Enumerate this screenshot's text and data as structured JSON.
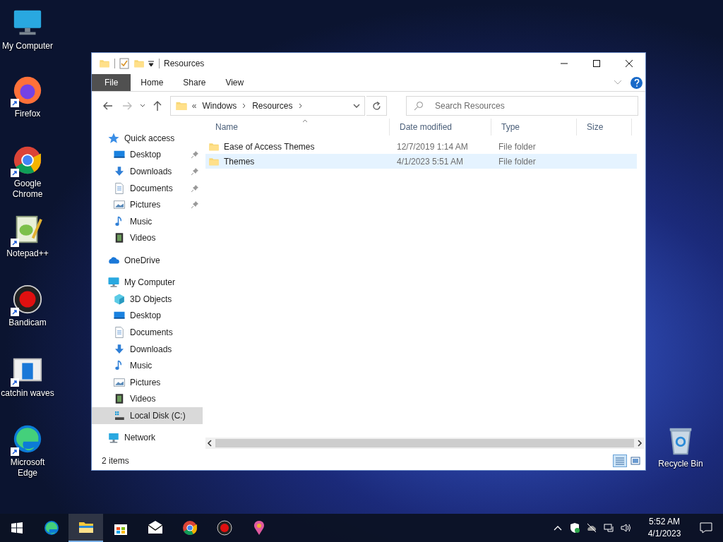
{
  "desktop_icons": [
    {
      "label": "My Computer",
      "kind": "monitor",
      "shortcut": false
    },
    {
      "label": "Firefox",
      "kind": "firefox",
      "shortcut": true
    },
    {
      "label": "Google Chrome",
      "kind": "chrome",
      "shortcut": true
    },
    {
      "label": "Notepad++",
      "kind": "notepad",
      "shortcut": true
    },
    {
      "label": "Bandicam",
      "kind": "record",
      "shortcut": true
    },
    {
      "label": "catchin waves",
      "kind": "app",
      "shortcut": true
    },
    {
      "label": "Microsoft Edge",
      "kind": "edge",
      "shortcut": true
    },
    {
      "label": "Recycle Bin",
      "kind": "bin",
      "shortcut": false
    }
  ],
  "window": {
    "title": "Resources"
  },
  "ribbon_tabs": [
    {
      "label": "File",
      "selected": true
    },
    {
      "label": "Home",
      "selected": false
    },
    {
      "label": "Share",
      "selected": false
    },
    {
      "label": "View",
      "selected": false
    }
  ],
  "address": {
    "overflow": "«",
    "segments": [
      "Windows",
      "Resources"
    ]
  },
  "search": {
    "placeholder": "Search Resources"
  },
  "navigation": [
    {
      "label": "Quick access",
      "kind": "star",
      "selected": false,
      "children": [
        {
          "label": "Desktop",
          "kind": "desktop",
          "pinned": true,
          "selected": false
        },
        {
          "label": "Downloads",
          "kind": "downloads",
          "pinned": true,
          "selected": false
        },
        {
          "label": "Documents",
          "kind": "documents",
          "pinned": true,
          "selected": false
        },
        {
          "label": "Pictures",
          "kind": "pictures",
          "pinned": true,
          "selected": false
        },
        {
          "label": "Music",
          "kind": "music",
          "pinned": false,
          "selected": false
        },
        {
          "label": "Videos",
          "kind": "videos",
          "pinned": false,
          "selected": false
        }
      ]
    },
    {
      "label": "OneDrive",
      "kind": "cloud",
      "selected": false
    },
    {
      "label": "My Computer",
      "kind": "monitor",
      "selected": false,
      "children": [
        {
          "label": "3D Objects",
          "kind": "cube",
          "pinned": false,
          "selected": false
        },
        {
          "label": "Desktop",
          "kind": "desktop",
          "pinned": false,
          "selected": false
        },
        {
          "label": "Documents",
          "kind": "documents",
          "pinned": false,
          "selected": false
        },
        {
          "label": "Downloads",
          "kind": "downloads",
          "pinned": false,
          "selected": false
        },
        {
          "label": "Music",
          "kind": "music",
          "pinned": false,
          "selected": false
        },
        {
          "label": "Pictures",
          "kind": "pictures",
          "pinned": false,
          "selected": false
        },
        {
          "label": "Videos",
          "kind": "videos",
          "pinned": false,
          "selected": false
        },
        {
          "label": "Local Disk (C:)",
          "kind": "disk",
          "pinned": false,
          "selected": true
        }
      ]
    },
    {
      "label": "Network",
      "kind": "network",
      "selected": false
    }
  ],
  "file_list": {
    "columns": [
      "Name",
      "Date modified",
      "Type",
      "Size"
    ],
    "rows": [
      {
        "name": "Ease of Access Themes",
        "date_modified": "12/7/2019 1:14 AM",
        "type": "File folder",
        "selected": false
      },
      {
        "name": "Themes",
        "date_modified": "4/1/2023 5:51 AM",
        "type": "File folder",
        "selected": true
      }
    ]
  },
  "status_bar": {
    "item_count": "2 items"
  },
  "taskbar": {
    "apps": [
      {
        "kind": "edge",
        "active": false
      },
      {
        "kind": "explorer",
        "active": true
      },
      {
        "kind": "store",
        "active": false
      },
      {
        "kind": "mail",
        "active": false
      },
      {
        "kind": "chrome",
        "active": false
      },
      {
        "kind": "record",
        "active": false
      },
      {
        "kind": "paint",
        "active": false
      }
    ],
    "time": "5:52 AM",
    "date": "4/1/2023"
  }
}
